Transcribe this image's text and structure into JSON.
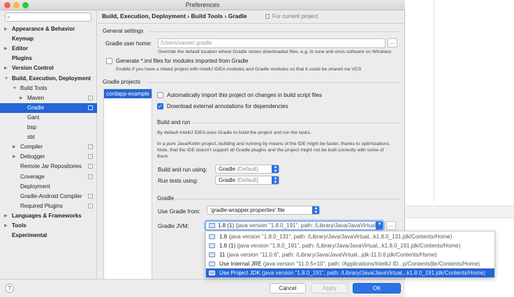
{
  "window": {
    "title": "Preferences"
  },
  "sidebar": {
    "search_placeholder": "",
    "items": [
      {
        "label": "Appearance & Behavior",
        "arrow": "▶",
        "bold": true
      },
      {
        "label": "Keymap",
        "arrow": "",
        "bold": true
      },
      {
        "label": "Editor",
        "arrow": "▶",
        "bold": true
      },
      {
        "label": "Plugins",
        "arrow": "",
        "bold": true
      },
      {
        "label": "Version Control",
        "arrow": "▶",
        "bold": true
      },
      {
        "label": "Build, Execution, Deployment",
        "arrow": "▼",
        "bold": true
      },
      {
        "label": "Build Tools",
        "arrow": "▼",
        "bold": false
      },
      {
        "label": "Maven",
        "arrow": "▶",
        "bold": false
      },
      {
        "label": "Gradle",
        "arrow": "",
        "bold": false
      },
      {
        "label": "Gant",
        "arrow": "",
        "bold": false
      },
      {
        "label": "bsp",
        "arrow": "",
        "bold": false
      },
      {
        "label": "sbt",
        "arrow": "",
        "bold": false
      },
      {
        "label": "Compiler",
        "arrow": "▶",
        "bold": false
      },
      {
        "label": "Debugger",
        "arrow": "▶",
        "bold": false
      },
      {
        "label": "Remote Jar Repositories",
        "arrow": "",
        "bold": false
      },
      {
        "label": "Coverage",
        "arrow": "",
        "bold": false
      },
      {
        "label": "Deployment",
        "arrow": "",
        "bold": false
      },
      {
        "label": "Gradle-Android Compiler",
        "arrow": "",
        "bold": false
      },
      {
        "label": "Required Plugins",
        "arrow": "",
        "bold": false
      },
      {
        "label": "Languages & Frameworks",
        "arrow": "▶",
        "bold": true
      },
      {
        "label": "Tools",
        "arrow": "▶",
        "bold": true
      },
      {
        "label": "Experimental",
        "arrow": "",
        "bold": true
      }
    ]
  },
  "breadcrumb": {
    "path": "Build, Execution, Deployment  ›  Build Tools  ›  Gradle",
    "scope": "For current project"
  },
  "general": {
    "title": "General settings",
    "home_label": "Gradle user home:",
    "home_placeholder": "/Users/xavier/.gradle",
    "home_hint": "Override the default location where Gradle stores downloaded files, e.g. to tune anti-virus software on Windows",
    "iml_label": "Generate *.iml files for modules imported from Gradle",
    "iml_hint": "Enable if you have a mixed project with IntelliJ IDEA modules and Gradle modules so that it could be shared via VCS"
  },
  "projects": {
    "title": "Gradle projects",
    "items": [
      "cordapp-example"
    ],
    "auto_import_label": "Automatically import this project on changes in build script files",
    "download_label": "Download external annotations for dependencies"
  },
  "build_run": {
    "title": "Build and run",
    "hint1": "By default IntelliJ IDEA uses Gradle to build the project and run the tasks.",
    "hint2a": "In a pure Java/Kotlin project, building and running by means of the IDE might be faster, thanks to optimizations.",
    "hint2b": "Note, that the IDE doesn't support all Gradle plugins and the project might not be built correctly with some of",
    "hint2c": "them.",
    "build_label": "Build and run using:",
    "build_value": "Gradle",
    "build_muted": "(Default)",
    "tests_label": "Run tests using:",
    "tests_value": "Gradle",
    "tests_muted": "(Default)"
  },
  "gradle": {
    "title": "Gradle",
    "use_from_label": "Use Gradle from:",
    "use_from_value": "'gradle-wrapper.properties' file",
    "jvm_label": "Gradle JVM:",
    "jvm_value": "1.8 (1)",
    "jvm_detail": "(java version \"1.8.0_191\", path: /Library/Java/JavaVirtual...",
    "options": [
      {
        "name": "1.8",
        "detail": "(java version \"1.8.0_131\", path: /Library/Java/JavaVirtual...k1.8.0_131.jdk/Contents/Home)",
        "selected": false
      },
      {
        "name": "1.8 (1)",
        "detail": "(java version \"1.8.0_191\", path: /Library/Java/JavaVirtual...k1.8.0_191.jdk/Contents/Home)",
        "selected": false
      },
      {
        "name": "11",
        "detail": "(java version \"11.0.6\", path: /Library/Java/JavaVirtual...jdk-11.0.6.jdk/Contents/Home)",
        "selected": false
      },
      {
        "name": "Use Internal JRE",
        "detail": "(java version \"11.0.5+10\", path: /Applications/IntelliJ ID...p/Contents/jbr/Contents/Home)",
        "selected": false
      },
      {
        "name": "Use Project JDK",
        "detail": "(java version \"1.8.0_191\", path: /Library/Java/JavaVirtual...k1.8.0_191.jdk/Contents/Home)",
        "selected": true
      }
    ]
  },
  "buttons": {
    "help": "?",
    "cancel": "Cancel",
    "apply": "Apply",
    "ok": "OK",
    "dots": "..."
  },
  "colors": {
    "accent": "#2a72e5",
    "selection": "#2565d6"
  }
}
